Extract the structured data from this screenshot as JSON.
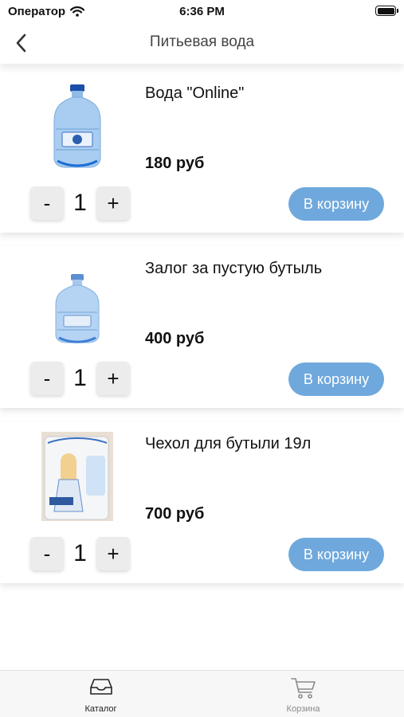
{
  "status_bar": {
    "carrier": "Оператор",
    "time": "6:36 PM"
  },
  "nav": {
    "title": "Питьевая вода"
  },
  "products": [
    {
      "name": "Вода \"Online\"",
      "price": "180 руб",
      "quantity": "1",
      "minus": "-",
      "plus": "+",
      "cart_button": "В корзину",
      "image": "water-bottle-19l"
    },
    {
      "name": "Залог за пустую бутыль",
      "price": "400 руб",
      "quantity": "1",
      "minus": "-",
      "plus": "+",
      "cart_button": "В корзину",
      "image": "empty-water-bottle"
    },
    {
      "name": "Чехол для бутыли 19л",
      "price": "700 руб",
      "quantity": "1",
      "minus": "-",
      "plus": "+",
      "cart_button": "В корзину",
      "image": "bottle-cover"
    }
  ],
  "tabs": [
    {
      "label": "Каталог",
      "icon": "tray-icon",
      "active": true
    },
    {
      "label": "Корзина",
      "icon": "cart-icon",
      "active": false
    }
  ],
  "colors": {
    "accent_button": "#6fa8dc",
    "tab_active": "#222222",
    "tab_inactive": "#8a8a8a"
  }
}
